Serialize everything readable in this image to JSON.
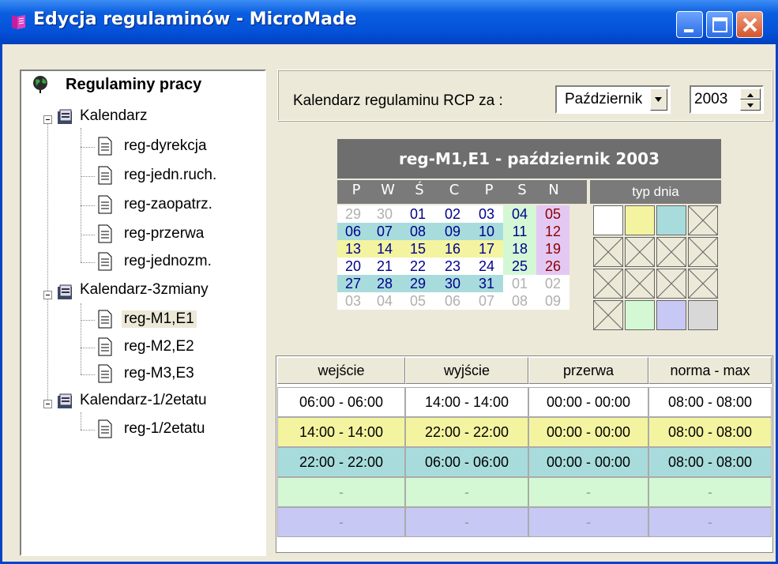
{
  "window": {
    "title": "Edycja regulaminów - MicroMade",
    "buttons": {
      "minimize": "minimize",
      "maximize": "maximize",
      "close": "close"
    }
  },
  "tree": {
    "root": "Regulaminy pracy",
    "groups": [
      {
        "label": "Kalendarz",
        "items": [
          "reg-dyrekcja",
          "reg-jedn.ruch.",
          "reg-zaopatrz.",
          "reg-przerwa",
          "reg-jednozm."
        ]
      },
      {
        "label": "Kalendarz-3zmiany",
        "items": [
          "reg-M1,E1",
          "reg-M2,E2",
          "reg-M3,E3"
        ]
      },
      {
        "label": "Kalendarz-1/2etatu",
        "items": [
          "reg-1/2etatu"
        ]
      }
    ],
    "selected": "reg-M1,E1"
  },
  "header": {
    "label": "Kalendarz regulaminu RCP  za :",
    "month": "Październik",
    "year": "2003"
  },
  "calendar": {
    "title": "reg-M1,E1 - październik 2003",
    "weekdays": [
      "P",
      "W",
      "Ś",
      "C",
      "P",
      "S",
      "N"
    ],
    "type_label": "typ dnia",
    "weeks": [
      [
        "29",
        "30",
        "01",
        "02",
        "03",
        "04",
        "05"
      ],
      [
        "06",
        "07",
        "08",
        "09",
        "10",
        "11",
        "12"
      ],
      [
        "13",
        "14",
        "15",
        "16",
        "17",
        "18",
        "19"
      ],
      [
        "20",
        "21",
        "22",
        "23",
        "24",
        "25",
        "26"
      ],
      [
        "27",
        "28",
        "29",
        "30",
        "31",
        "01",
        "02"
      ],
      [
        "03",
        "04",
        "05",
        "06",
        "07",
        "08",
        "09"
      ]
    ],
    "colors": {
      "white": "#ffffff",
      "yellow": "#f4f4a0",
      "teal": "#a8dcdc",
      "mint": "#d4f8d4",
      "lavender": "#c8c8f4",
      "gray": "#d8d8d8",
      "pink": "#e4c8f4"
    }
  },
  "shifts": {
    "headers": [
      "wejście",
      "wyjście",
      "przerwa",
      "norma - max"
    ],
    "rows": [
      [
        "06:00 - 06:00",
        "14:00 - 14:00",
        "00:00 - 00:00",
        "08:00 - 08:00"
      ],
      [
        "14:00 - 14:00",
        "22:00 - 22:00",
        "00:00 - 00:00",
        "08:00 - 08:00"
      ],
      [
        "22:00 - 22:00",
        "06:00 - 06:00",
        "00:00 - 00:00",
        "08:00 - 08:00"
      ],
      [
        "-",
        "-",
        "-",
        "-"
      ],
      [
        "-",
        "-",
        "-",
        "-"
      ]
    ],
    "row_colors": [
      "#ffffff",
      "#f4f4a0",
      "#a8dcdc",
      "#d4f8d4",
      "#c8c8f4"
    ]
  }
}
